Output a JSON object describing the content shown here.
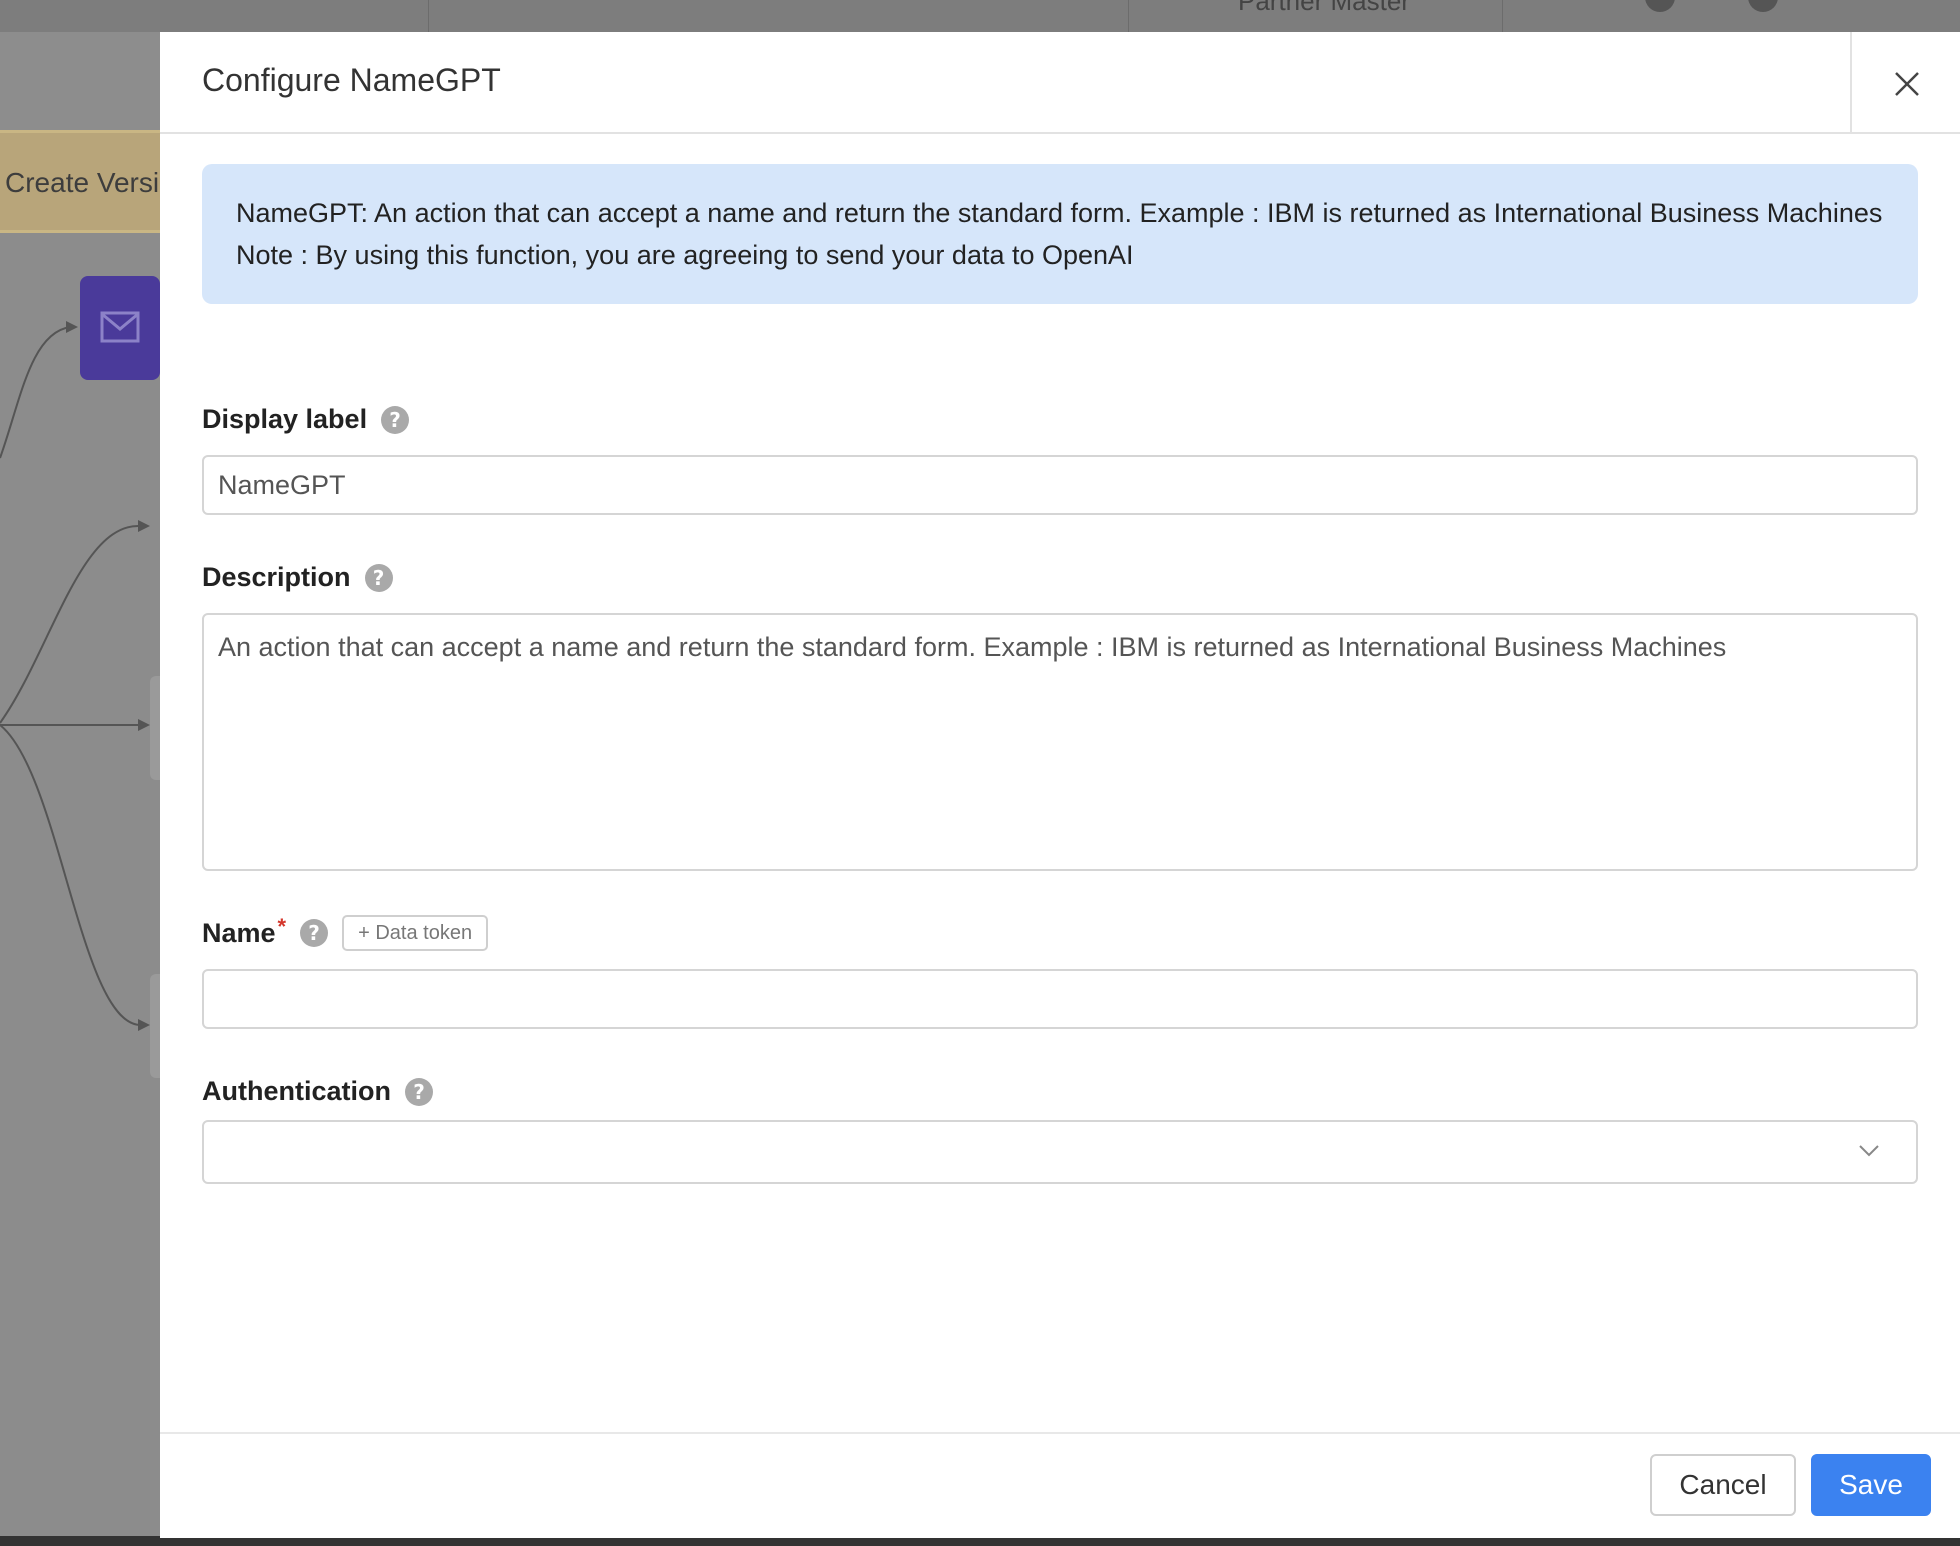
{
  "background": {
    "top_partial_text": "Partner Master",
    "versions_button_label": "Create Versi",
    "node_icon": "envelope-icon"
  },
  "modal": {
    "title": "Configure NameGPT",
    "close_icon": "close-icon",
    "info_text": "NameGPT: An action that can accept a name and return the standard form. Example : IBM is returned as International Business Machines Note : By using this function, you are agreeing to send your data to OpenAI",
    "fields": {
      "display_label": {
        "label": "Display label",
        "help": "?",
        "value": "NameGPT"
      },
      "description": {
        "label": "Description",
        "help": "?",
        "value": "An action that can accept a name and return the standard form. Example : IBM is returned as International Business Machines"
      },
      "name": {
        "label": "Name",
        "required_marker": "*",
        "help": "?",
        "data_token_label": "+ Data token",
        "value": ""
      },
      "authentication": {
        "label": "Authentication",
        "help": "?",
        "value": "",
        "icon": "chevron-down-icon"
      }
    },
    "footer": {
      "cancel_label": "Cancel",
      "save_label": "Save"
    }
  },
  "colors": {
    "info_bg": "#d6e6fa",
    "primary": "#3b82f0",
    "required": "#d4372c",
    "node": "#4a3a9a"
  }
}
